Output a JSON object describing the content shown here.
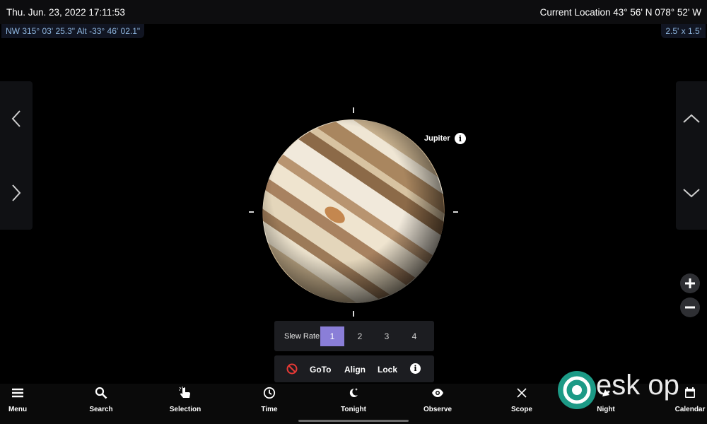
{
  "status": {
    "datetime": "Thu. Jun. 23, 2022  17:11:53",
    "location": "Current Location  43° 56' N 078° 52' W",
    "pointing": "NW 315° 03' 25.3\" Alt -33° 46' 02.1\"",
    "fov": "2.5' x  1.5'"
  },
  "object": {
    "name": "Jupiter",
    "info_icon": "info-icon"
  },
  "slew": {
    "label": "Slew Rate:",
    "options": [
      "1",
      "2",
      "3",
      "4"
    ],
    "selected": "1",
    "accent_color": "#8a7ed8"
  },
  "actions": {
    "stop_icon": "no-entry-icon",
    "goto": "GoTo",
    "align": "Align",
    "lock": "Lock"
  },
  "side_controls": {
    "left": [
      "chevron-left-icon",
      "chevron-right-icon"
    ],
    "right": [
      "chevron-up-icon",
      "chevron-down-icon"
    ],
    "zoom": [
      "plus-icon",
      "minus-icon"
    ]
  },
  "nav": [
    {
      "label": "Menu",
      "icon": "menu-icon"
    },
    {
      "label": "Search",
      "icon": "search-icon"
    },
    {
      "label": "Selection",
      "icon": "pointer-icon"
    },
    {
      "label": "Time",
      "icon": "clock-icon"
    },
    {
      "label": "Tonight",
      "icon": "moon-stars-icon"
    },
    {
      "label": "Observe",
      "icon": "eye-icon"
    },
    {
      "label": "Scope",
      "icon": "crosshair-icon"
    },
    {
      "label": "Night",
      "icon": "night-icon"
    },
    {
      "label": "Calendar",
      "icon": "calendar-icon"
    }
  ],
  "watermark": {
    "text": "esk op"
  }
}
